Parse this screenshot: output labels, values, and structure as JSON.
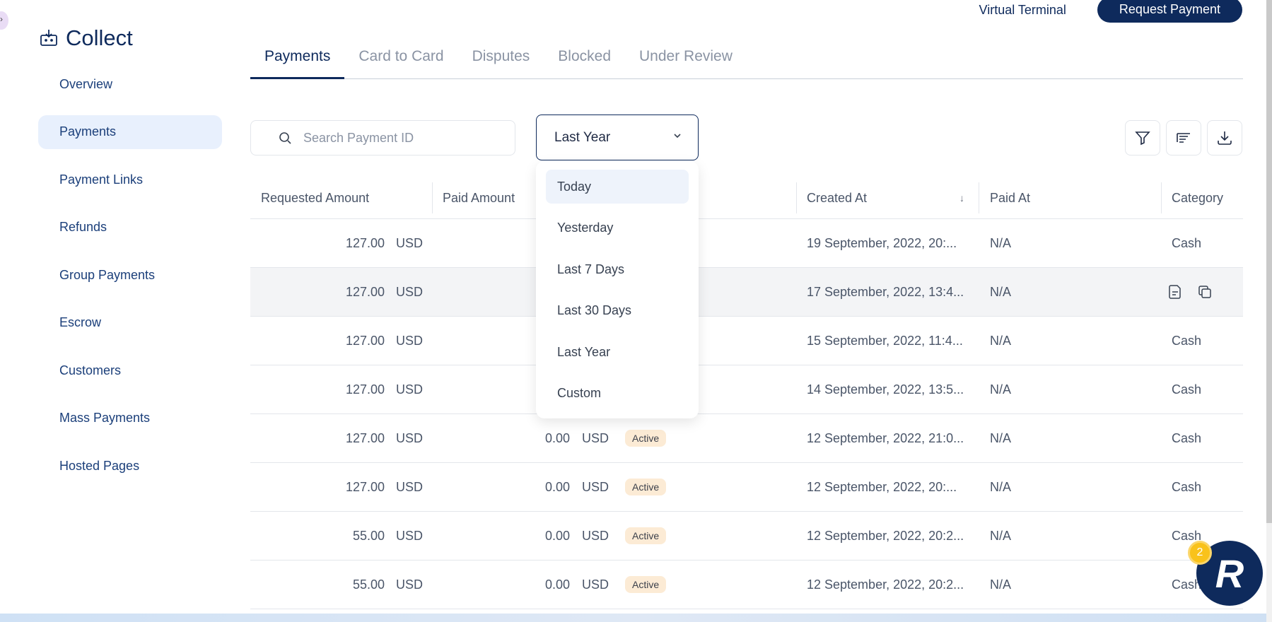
{
  "brand": {
    "title": "Collect",
    "icon": "collect-icon"
  },
  "sidebar": {
    "items": [
      {
        "label": "Overview",
        "active": false
      },
      {
        "label": "Payments",
        "active": true
      },
      {
        "label": "Payment Links",
        "active": false
      },
      {
        "label": "Refunds",
        "active": false
      },
      {
        "label": "Group Payments",
        "active": false
      },
      {
        "label": "Escrow",
        "active": false
      },
      {
        "label": "Customers",
        "active": false
      },
      {
        "label": "Mass Payments",
        "active": false
      },
      {
        "label": "Hosted Pages",
        "active": false
      }
    ]
  },
  "top_actions": {
    "virtual_terminal": "Virtual Terminal",
    "request_payment": "Request Payment"
  },
  "tabs": [
    {
      "label": "Payments",
      "active": true
    },
    {
      "label": "Card to Card",
      "active": false
    },
    {
      "label": "Disputes",
      "active": false
    },
    {
      "label": "Blocked",
      "active": false
    },
    {
      "label": "Under Review",
      "active": false
    }
  ],
  "search": {
    "placeholder": "Search Payment ID",
    "value": ""
  },
  "date_filter": {
    "selected": "Last Year",
    "options": [
      "Today",
      "Yesterday",
      "Last 7 Days",
      "Last 30 Days",
      "Last Year",
      "Custom"
    ],
    "highlighted": "Today"
  },
  "toolbar_icons": [
    "filter-icon",
    "sort-icon",
    "download-icon"
  ],
  "table": {
    "headers": {
      "requested_amount": "Requested Amount",
      "paid_amount": "Paid Amount",
      "created_at": "Created At",
      "paid_at": "Paid At",
      "category": "Category"
    },
    "rows": [
      {
        "req": "127.00",
        "req_cur": "USD",
        "paid": "",
        "paid_cur": "",
        "status": "",
        "created": "19 September, 2022, 20:...",
        "paid_at": "N/A",
        "category": "Cash",
        "hover": false
      },
      {
        "req": "127.00",
        "req_cur": "USD",
        "paid": "",
        "paid_cur": "",
        "status": "",
        "created": "17 September, 2022, 13:4...",
        "paid_at": "N/A",
        "category": "",
        "hover": true
      },
      {
        "req": "127.00",
        "req_cur": "USD",
        "paid": "",
        "paid_cur": "",
        "status": "",
        "created": "15 September, 2022, 11:4...",
        "paid_at": "N/A",
        "category": "Cash",
        "hover": false
      },
      {
        "req": "127.00",
        "req_cur": "USD",
        "paid": "",
        "paid_cur": "",
        "status": "",
        "created": "14 September, 2022, 13:5...",
        "paid_at": "N/A",
        "category": "Cash",
        "hover": false
      },
      {
        "req": "127.00",
        "req_cur": "USD",
        "paid": "0.00",
        "paid_cur": "USD",
        "status": "Active",
        "created": "12 September, 2022, 21:0...",
        "paid_at": "N/A",
        "category": "Cash",
        "hover": false
      },
      {
        "req": "127.00",
        "req_cur": "USD",
        "paid": "0.00",
        "paid_cur": "USD",
        "status": "Active",
        "created": "12 September, 2022, 20:...",
        "paid_at": "N/A",
        "category": "Cash",
        "hover": false
      },
      {
        "req": "55.00",
        "req_cur": "USD",
        "paid": "0.00",
        "paid_cur": "USD",
        "status": "Active",
        "created": "12 September, 2022, 20:2...",
        "paid_at": "N/A",
        "category": "Cash",
        "hover": false
      },
      {
        "req": "55.00",
        "req_cur": "USD",
        "paid": "0.00",
        "paid_cur": "USD",
        "status": "Active",
        "created": "12 September, 2022, 20:2...",
        "paid_at": "N/A",
        "category": "Cash",
        "hover": false
      }
    ]
  },
  "chat_widget": {
    "letter": "R",
    "badge_count": "2"
  },
  "colors": {
    "primary": "#0e2a5c",
    "nav_active_bg": "#e8f0fd",
    "badge_bg": "#fcebd5",
    "widget_badge": "#f9c21b"
  }
}
